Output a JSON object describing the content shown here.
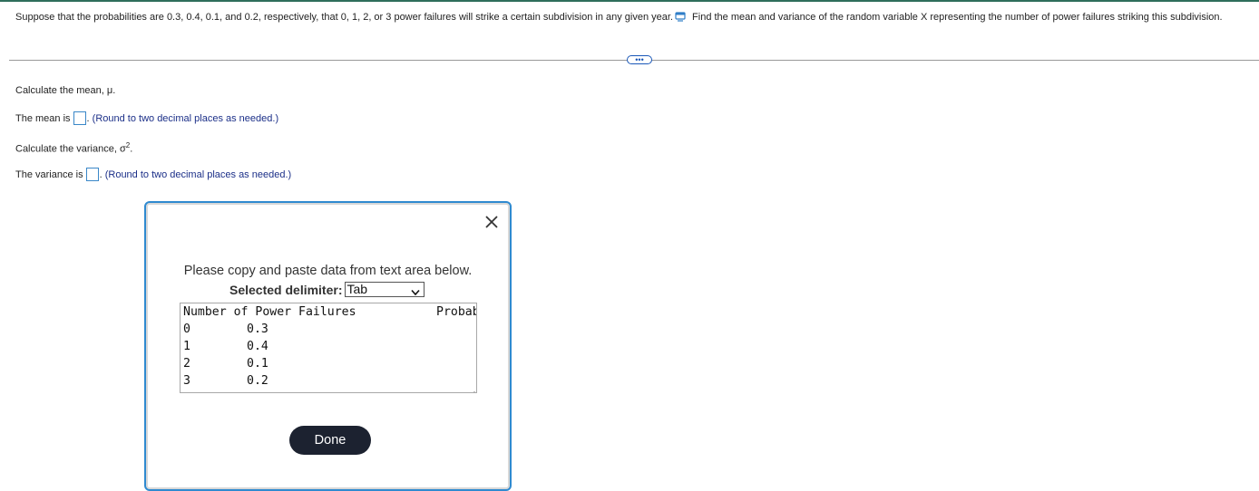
{
  "question": {
    "text": "Suppose that the probabilities are 0.3, 0.4, 0.1, and 0.2, respectively, that 0, 1, 2, or 3 power failures will strike a certain subdivision in any given year.",
    "icon": "data-table-icon",
    "text2": "Find the mean and variance of the random variable X representing the number of power failures striking this subdivision."
  },
  "more_button": {
    "label": "•••"
  },
  "mean_section": {
    "prompt": "Calculate the mean, μ.",
    "label": "The mean is",
    "suffix": ".",
    "hint": "(Round to two decimal places as needed.)"
  },
  "variance_section": {
    "prompt_base": "Calculate the variance, σ",
    "prompt_sup": "2",
    "prompt_end": ".",
    "label": "The variance is",
    "suffix": ".",
    "hint": "(Round to two decimal places as needed.)"
  },
  "modal": {
    "instruction": "Please copy and paste data from text area below.",
    "delimiter_label": "Selected delimiter:",
    "delimiter_value": "Tab",
    "columns": [
      "Number of Power Failures",
      "Probab"
    ],
    "rows": [
      {
        "x": "0",
        "p": "0.3"
      },
      {
        "x": "1",
        "p": "0.4"
      },
      {
        "x": "2",
        "p": "0.1"
      },
      {
        "x": "3",
        "p": "0.2"
      }
    ],
    "done_label": "Done",
    "close_icon": "close-icon"
  },
  "colors": {
    "accent_blue": "#2f8ad0",
    "hint_text": "#1b2f88",
    "done_button": "#1c2230"
  }
}
